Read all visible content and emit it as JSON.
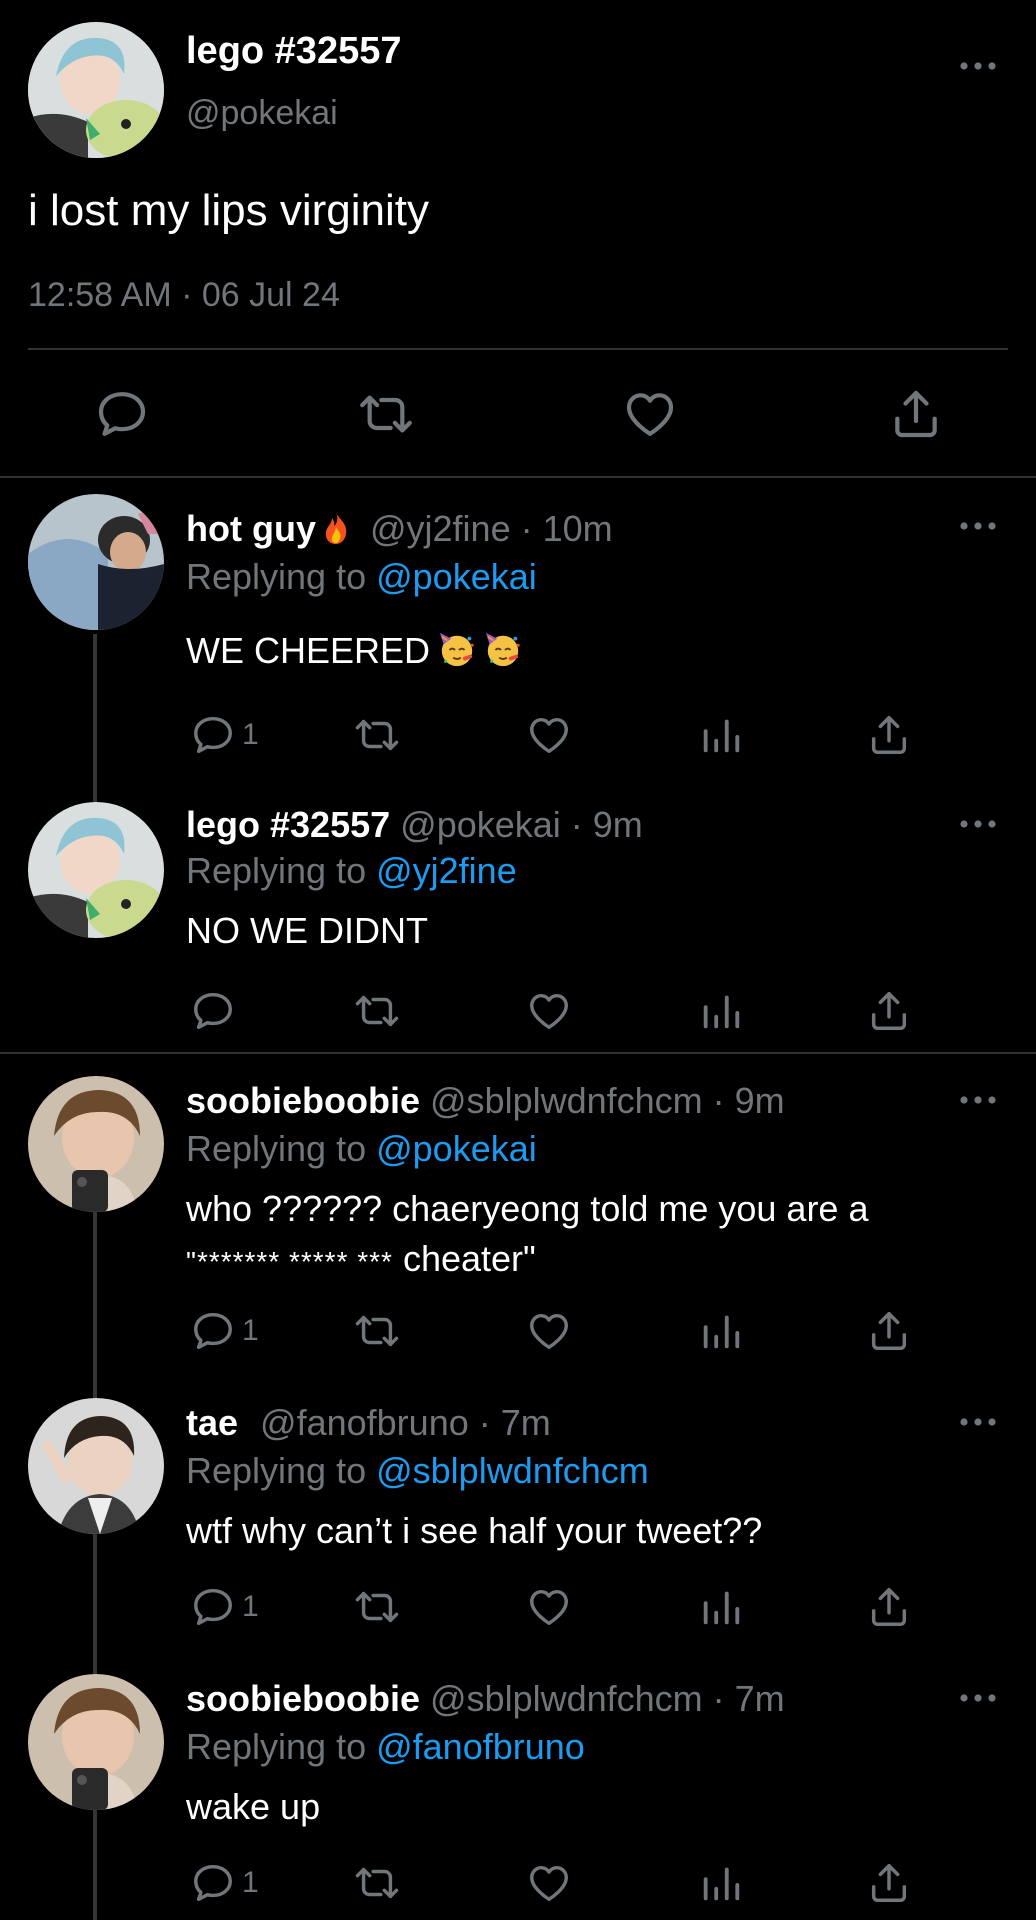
{
  "main_tweet": {
    "display_name": "lego #32557",
    "handle": "@pokekai",
    "text": "i lost my lips virginity",
    "timestamp": "12:58 AM · 06 Jul 24"
  },
  "replies": [
    {
      "display_name": "hot guy",
      "name_emoji": "fire-emoji",
      "handle": "@yj2fine",
      "meta": "@yj2fine · 10m",
      "replying_prefix": "Replying to ",
      "replying_to": "@pokekai",
      "text": "WE CHEERED",
      "text_emojis": [
        "partying-face-emoji",
        "partying-face-emoji"
      ],
      "reply_count": "1"
    },
    {
      "display_name": "lego #32557",
      "meta": "@pokekai · 9m",
      "replying_prefix": "Replying to ",
      "replying_to": "@yj2fine",
      "text": "NO WE DIDNT",
      "reply_count": ""
    },
    {
      "display_name": "soobieboobie",
      "meta": "@sblplwdnfchcm · 9m",
      "replying_prefix": "Replying to ",
      "replying_to": "@pokekai",
      "text_line1": "who ?????? chaeryeong told me you are a",
      "text_line2_prefix": "\"******* ***** ***",
      "text_line2_suffix": " cheater\"",
      "reply_count": "1"
    },
    {
      "display_name": "tae",
      "meta": "@fanofbruno · 7m",
      "replying_prefix": "Replying to ",
      "replying_to": "@sblplwdnfchcm",
      "text": "wtf why can’t i see half your tweet??",
      "reply_count": "1"
    },
    {
      "display_name": "soobieboobie",
      "meta": "@sblplwdnfchcm · 7m",
      "replying_prefix": "Replying to ",
      "replying_to": "@fanofbruno",
      "text": "wake up",
      "reply_count": "1"
    }
  ],
  "colors": {
    "background": "#000000",
    "text": "#e7e9ea",
    "secondary": "#71767b",
    "link": "#1d9bf0",
    "divider": "#2f3336"
  },
  "icons": [
    "more-icon",
    "reply-icon",
    "retweet-icon",
    "like-icon",
    "share-icon",
    "views-icon"
  ]
}
